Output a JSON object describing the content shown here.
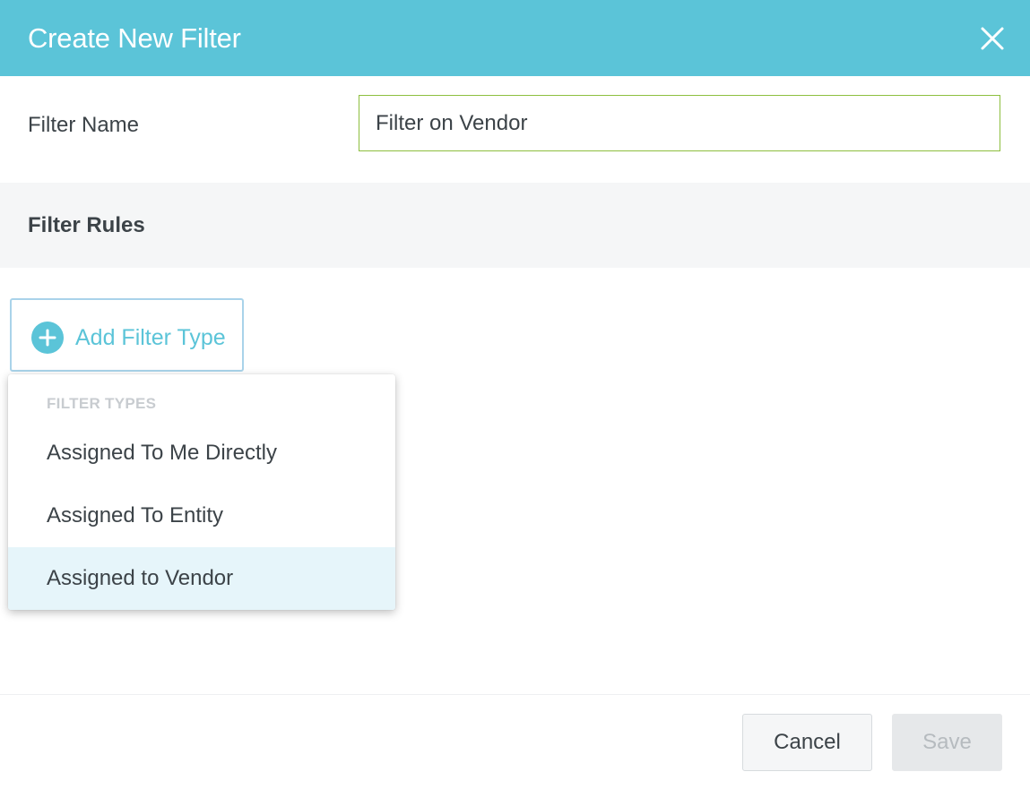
{
  "dialog": {
    "title": "Create New Filter",
    "close_icon": "close-icon"
  },
  "filter_name": {
    "label": "Filter Name",
    "value": "Filter on Vendor"
  },
  "filter_rules": {
    "title": "Filter Rules",
    "add_button": {
      "icon": "plus-circle-icon",
      "label": "Add Filter Type"
    }
  },
  "filter_types_menu": {
    "header": "FILTER TYPES",
    "items": [
      {
        "label": "Assigned To Me Directly",
        "highlighted": false
      },
      {
        "label": "Assigned To Entity",
        "highlighted": false
      },
      {
        "label": "Assigned to Vendor",
        "highlighted": true
      }
    ]
  },
  "footer": {
    "cancel_label": "Cancel",
    "save_label": "Save",
    "save_disabled": true
  },
  "colors": {
    "header_bg": "#5bc4d8",
    "accent": "#5bc4d8",
    "input_border": "#8dbf3f",
    "highlight_bg": "#e6f5fa"
  }
}
